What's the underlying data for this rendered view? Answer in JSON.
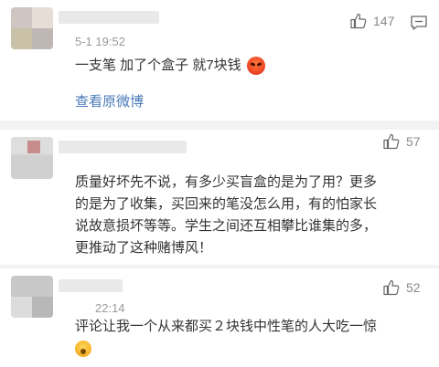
{
  "comments": [
    {
      "time": "5-1 19:52",
      "text": "一支笔 加了个盒子 就7块钱",
      "likes": "147",
      "link": "查看原微博",
      "emoji": "angry-face-icon"
    },
    {
      "time": "",
      "text_lines": [
        "质量好坏先不说，有多少买盲盒的是为了用？更多",
        "的是为了收集，买回来的笔没怎么用，有的怕家长",
        "说故意损坏等等。学生之间还互相攀比谁集的多，",
        "更推动了这种赌博风！"
      ],
      "likes": "57"
    },
    {
      "time": "22:14",
      "text": "评论让我一个从来都买２块钱中性笔的人大吃一惊",
      "likes": "52",
      "emoji": "shocked-face-icon"
    }
  ],
  "colors": {
    "text": "#333333",
    "meta": "#9a9a9a",
    "link": "#4a7ab8",
    "divider": "#f2f2f2"
  }
}
